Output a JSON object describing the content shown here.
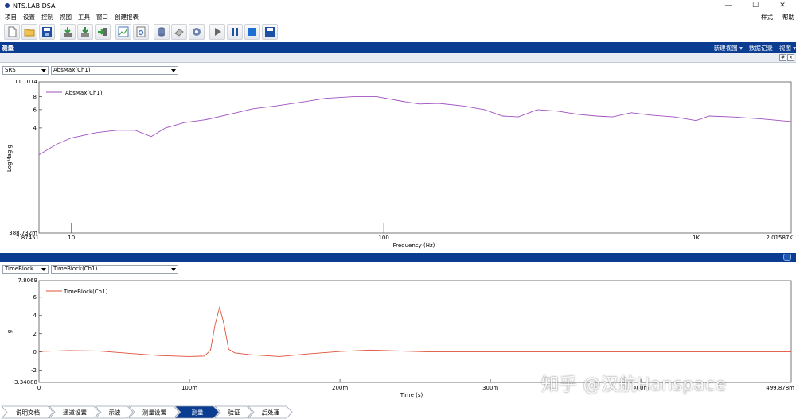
{
  "window": {
    "title": "NTS.LAB DSA",
    "minimize": "—",
    "maximize": "☐",
    "close": "✕"
  },
  "menu": {
    "items": [
      "项目",
      "设置",
      "控制",
      "视图",
      "工具",
      "窗口",
      "创建报表"
    ],
    "right": [
      "样式",
      "帮助"
    ]
  },
  "toolbar": {
    "buttons": [
      "new-document",
      "open-folder",
      "save",
      "import-down",
      "export-down",
      "load-arrow",
      "chart-view",
      "settings-page",
      "database",
      "eraser",
      "gear",
      "play",
      "pause",
      "stop",
      "save-data"
    ]
  },
  "panel": {
    "title": "测量",
    "actions": [
      "新建视图 ▾",
      "数据记录",
      "视图 ▾"
    ]
  },
  "top_chart": {
    "mode": "SRS",
    "channel": "AbsMax(Ch1)",
    "legend": "AbsMax(Ch1)",
    "ylabel": "LogMag g",
    "xlabel": "Frequency (Hz)",
    "y_top_label": "11.1014",
    "y_bottom_label": "388.732m",
    "x_left_label": "7.87451",
    "x_right_label": "2.01587K",
    "y_ticks": [
      "8",
      "6",
      "4"
    ],
    "x_ticks": [
      "10",
      "100",
      "1K"
    ],
    "color": "#a050c0"
  },
  "bottom_chart": {
    "mode": "TimeBlock",
    "channel": "TimeBlock(Ch1)",
    "legend": "TimeBlock(Ch1)",
    "ylabel": "g",
    "xlabel": "Time (s)",
    "y_top_label": "7.8069",
    "y_bottom_label": "-3.34088",
    "x_left_label": "0",
    "x_right_label": "499.878m",
    "y_ticks": [
      "6",
      "4",
      "2",
      "0",
      "-2"
    ],
    "x_ticks": [
      "100m",
      "200m",
      "300m",
      "400m"
    ],
    "color": "#e0503a"
  },
  "chart_data": [
    {
      "type": "line",
      "title": "",
      "xlabel": "Frequency (Hz)",
      "ylabel": "LogMag g",
      "x_scale": "log",
      "y_scale": "log",
      "xlim": [
        7.87451,
        2015.87
      ],
      "ylim": [
        0.388732,
        11.1014
      ],
      "grid": false,
      "legend": "top-left",
      "series": [
        {
          "name": "AbsMax(Ch1)",
          "x": [
            7.87,
            9,
            10,
            12,
            14,
            16,
            18,
            20,
            23,
            27,
            32,
            38,
            45,
            55,
            65,
            80,
            95,
            115,
            130,
            150,
            180,
            210,
            240,
            270,
            310,
            360,
            420,
            480,
            540,
            620,
            720,
            850,
            1000,
            1100,
            1300,
            1600,
            2015
          ],
          "y": [
            2.2,
            2.8,
            3.2,
            3.6,
            3.8,
            3.8,
            3.3,
            4.0,
            4.5,
            4.8,
            5.4,
            6.1,
            6.5,
            7.1,
            7.7,
            8.0,
            8.0,
            7.2,
            6.8,
            6.9,
            6.5,
            6.0,
            5.2,
            5.1,
            6.0,
            5.8,
            5.4,
            5.2,
            5.1,
            5.6,
            5.3,
            5.1,
            4.7,
            5.2,
            5.1,
            4.9,
            4.6
          ]
        }
      ]
    },
    {
      "type": "line",
      "title": "",
      "xlabel": "Time (s)",
      "ylabel": "g",
      "xlim": [
        0,
        0.499878
      ],
      "ylim": [
        -3.34088,
        7.8069
      ],
      "grid": false,
      "legend": "top-left",
      "series": [
        {
          "name": "TimeBlock(Ch1)",
          "x": [
            0,
            0.02,
            0.04,
            0.06,
            0.08,
            0.1,
            0.11,
            0.114,
            0.117,
            0.12,
            0.123,
            0.126,
            0.13,
            0.14,
            0.16,
            0.18,
            0.2,
            0.22,
            0.24,
            0.26,
            0.3,
            0.35,
            0.4,
            0.45,
            0.499878
          ],
          "y": [
            0.05,
            0.15,
            0.1,
            -0.15,
            -0.4,
            -0.5,
            -0.45,
            0.2,
            3.0,
            4.9,
            3.0,
            0.3,
            -0.1,
            -0.3,
            -0.5,
            -0.2,
            0.05,
            0.2,
            0.1,
            0.0,
            0.0,
            0.0,
            0.0,
            0.0,
            0.0
          ]
        }
      ]
    }
  ],
  "tabs": [
    "说明文档",
    "通道设置",
    "示波",
    "测量设置",
    "测量",
    "验证",
    "后处理"
  ],
  "active_tab": "测量",
  "watermark": "知乎 @汉航Hanspace"
}
